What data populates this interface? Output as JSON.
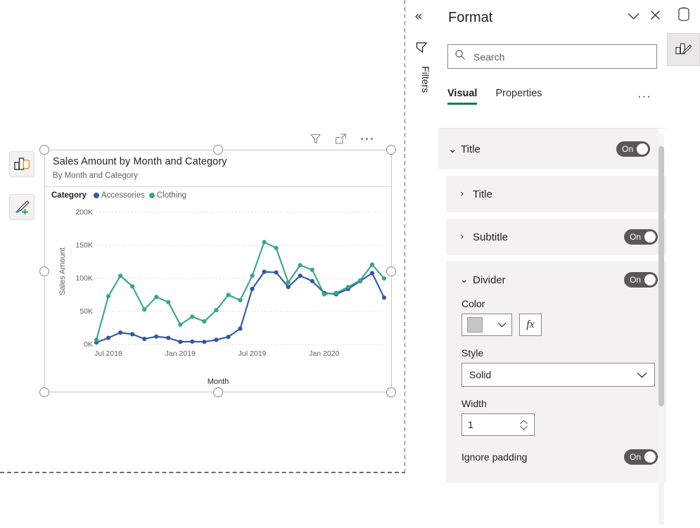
{
  "canvas": {
    "float_buttons": [
      {
        "name": "data-fields-icon",
        "icon": "bar-chart-data-icon"
      },
      {
        "name": "format-paint-icon",
        "icon": "paintbrush-plus-icon"
      }
    ]
  },
  "visual": {
    "title": "Sales Amount by Month and Category",
    "subtitle": "By Month and Category",
    "header_icons": [
      {
        "name": "filter-icon",
        "label": "Filters"
      },
      {
        "name": "focus-mode-icon",
        "label": "Focus mode"
      },
      {
        "name": "more-options-icon",
        "label": "More options"
      }
    ],
    "legend_title": "Category"
  },
  "chart_data": {
    "type": "line",
    "title": "Sales Amount by Month and Category",
    "subtitle": "By Month and Category",
    "xlabel": "Month",
    "ylabel": "Sales Amount",
    "ylim": [
      0,
      200000
    ],
    "yticks": [
      0,
      50000,
      100000,
      150000,
      200000
    ],
    "ytick_labels": [
      "0K",
      "50K",
      "100K",
      "150K",
      "200K"
    ],
    "grid": true,
    "legend_position": "top",
    "legend_title": "Category",
    "xtick_labels": [
      "Jul 2018",
      "Jan 2019",
      "Jul 2019",
      "Jan 2020"
    ],
    "xtick_indices": [
      1,
      7,
      13,
      19
    ],
    "x": [
      "Jun 2018",
      "Jul 2018",
      "Aug 2018",
      "Sep 2018",
      "Oct 2018",
      "Nov 2018",
      "Dec 2018",
      "Jan 2019",
      "Feb 2019",
      "Mar 2019",
      "Apr 2019",
      "May 2019",
      "Jun 2019",
      "Jul 2019",
      "Aug 2019",
      "Sep 2019",
      "Oct 2019",
      "Nov 2019",
      "Dec 2019",
      "Jan 2020",
      "Feb 2020",
      "Mar 2020",
      "Apr 2020",
      "May 2020",
      "Jun 2020"
    ],
    "series": [
      {
        "name": "Accessories",
        "color": "#3257A8",
        "values": [
          3000,
          10000,
          18000,
          15500,
          8500,
          12000,
          10000,
          4000,
          4500,
          4000,
          7000,
          11500,
          24000,
          84000,
          110000,
          109000,
          87000,
          104000,
          96000,
          78000,
          76000,
          84000,
          96000,
          108000,
          71000
        ]
      },
      {
        "name": "Clothing",
        "color": "#37A58C",
        "values": [
          7000,
          73000,
          104000,
          88000,
          53000,
          72000,
          64000,
          30000,
          42000,
          35000,
          52000,
          75000,
          67000,
          104000,
          155000,
          146000,
          94000,
          120000,
          113000,
          76000,
          78000,
          87000,
          97000,
          121000,
          100000
        ]
      }
    ]
  },
  "filters_rail": {
    "collapse_label": "«",
    "title": "Filters",
    "funnel_icon": "filter-funnel-icon"
  },
  "format_pane": {
    "title": "Format",
    "collapse_icon": "chevron-down-icon",
    "close_icon": "close-icon",
    "search": {
      "placeholder": "Search",
      "value": "",
      "icon": "search-icon"
    },
    "tabs": [
      {
        "label": "Visual",
        "active": true
      },
      {
        "label": "Properties",
        "active": false
      }
    ],
    "tabs_more": "···",
    "groups": [
      {
        "label": "Title",
        "expanded": true,
        "toggle": "On"
      }
    ],
    "cards": [
      {
        "label": "Title",
        "expanded": false,
        "toggle": null
      },
      {
        "label": "Subtitle",
        "expanded": false,
        "toggle": "On"
      },
      {
        "label": "Divider",
        "expanded": true,
        "toggle": "On",
        "fields": {
          "color_label": "Color",
          "color_value": "#c8c6c4",
          "fx_label": "fx",
          "style_label": "Style",
          "style_value": "Solid",
          "width_label": "Width",
          "width_value": "1",
          "ignore_padding_label": "Ignore padding",
          "ignore_padding_toggle": "On"
        }
      }
    ],
    "accent_color": "#117865"
  },
  "right_rail": {
    "buttons": [
      {
        "name": "data-pane-icon",
        "label": "Data"
      },
      {
        "name": "format-pane-icon",
        "label": "Format",
        "active": true
      }
    ]
  }
}
